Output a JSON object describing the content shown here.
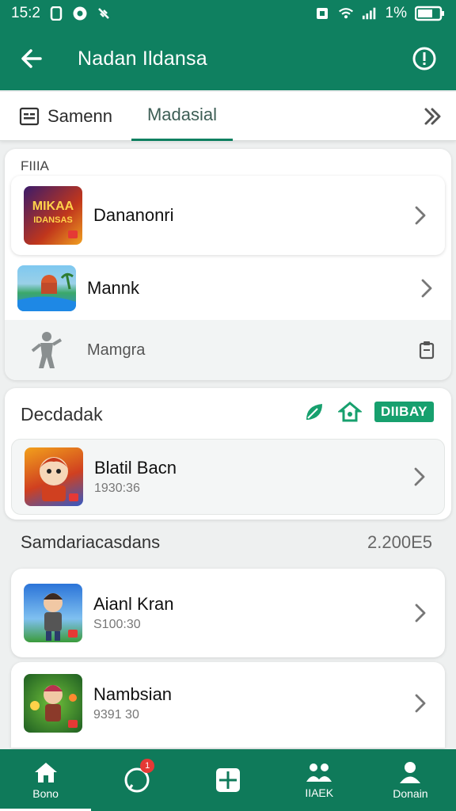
{
  "status_bar": {
    "time": "15:2",
    "battery": "1%"
  },
  "app_bar": {
    "title": "Nadan Ildansa"
  },
  "tabs": [
    {
      "label": "Samenn"
    },
    {
      "label": "Madasial"
    }
  ],
  "section1": {
    "label": "FIIIA",
    "items": [
      {
        "name": "Dananonri",
        "thumb_text": "MIKAA IDANSAS"
      },
      {
        "name": "Mannk"
      },
      {
        "name": "Mamgra"
      }
    ]
  },
  "section2": {
    "label": "Decdadak",
    "badge": "DIIBAY",
    "items": [
      {
        "name": "Blatil Bacn",
        "sub": "1930:36"
      }
    ]
  },
  "section3": {
    "label": "Samdariacasdans",
    "value": "2.200E5",
    "items": [
      {
        "name": "Aianl Kran",
        "sub": "S100:30"
      },
      {
        "name": "Nambsian",
        "sub": "9391 30"
      }
    ]
  },
  "bottom_nav": {
    "items": [
      {
        "label": "Bono"
      },
      {
        "label": ""
      },
      {
        "label": ""
      },
      {
        "label": "IIAEK"
      },
      {
        "label": "Donain"
      }
    ],
    "notif_count": "1"
  }
}
